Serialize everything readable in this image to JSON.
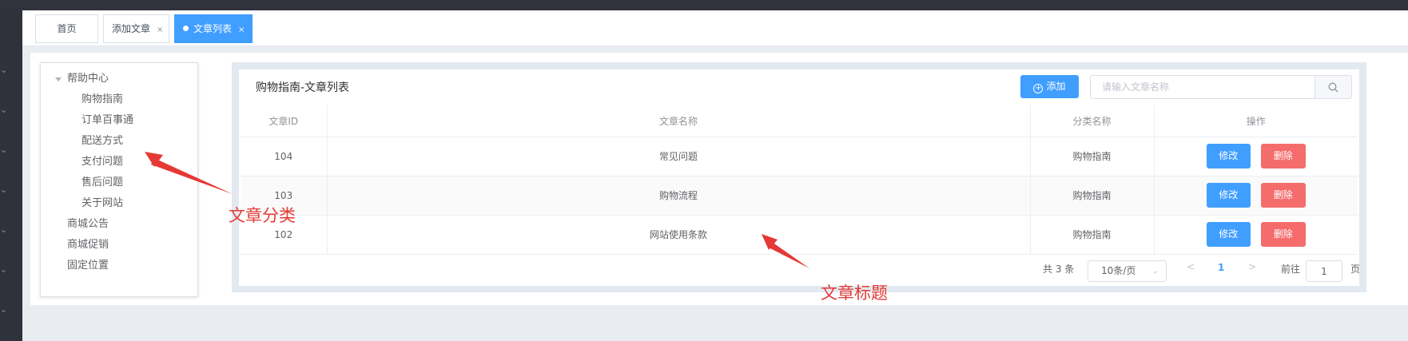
{
  "tabs": [
    {
      "label": "首页"
    },
    {
      "label": "添加文章",
      "close": "×"
    },
    {
      "label": "文章列表",
      "close": "×",
      "active": true
    }
  ],
  "tree": {
    "root": "帮助中心",
    "children": [
      "购物指南",
      "订单百事通",
      "配送方式",
      "支付问题",
      "售后问题",
      "关于网站"
    ],
    "others": [
      "商城公告",
      "商城促销",
      "固定位置"
    ]
  },
  "panel": {
    "title": "购物指南-文章列表",
    "add_label": "添加",
    "search_placeholder": "请输入文章名称"
  },
  "table": {
    "columns": [
      "文章ID",
      "文章名称",
      "分类名称",
      "操作"
    ],
    "rows": [
      {
        "id": "104",
        "name": "常见问题",
        "category": "购物指南"
      },
      {
        "id": "103",
        "name": "购物流程",
        "category": "购物指南"
      },
      {
        "id": "102",
        "name": "网站使用条款",
        "category": "购物指南"
      }
    ],
    "edit_label": "修改",
    "delete_label": "删除"
  },
  "pagination": {
    "total": "共 3 条",
    "page_size": "10条/页",
    "current": "1",
    "goto_prefix": "前往",
    "goto_value": "1",
    "goto_suffix": "页"
  },
  "annotations": {
    "category": "文章分类",
    "title": "文章标题"
  },
  "colors": {
    "primary": "#409eff",
    "danger": "#f56c6c",
    "annotation": "#e53935"
  }
}
